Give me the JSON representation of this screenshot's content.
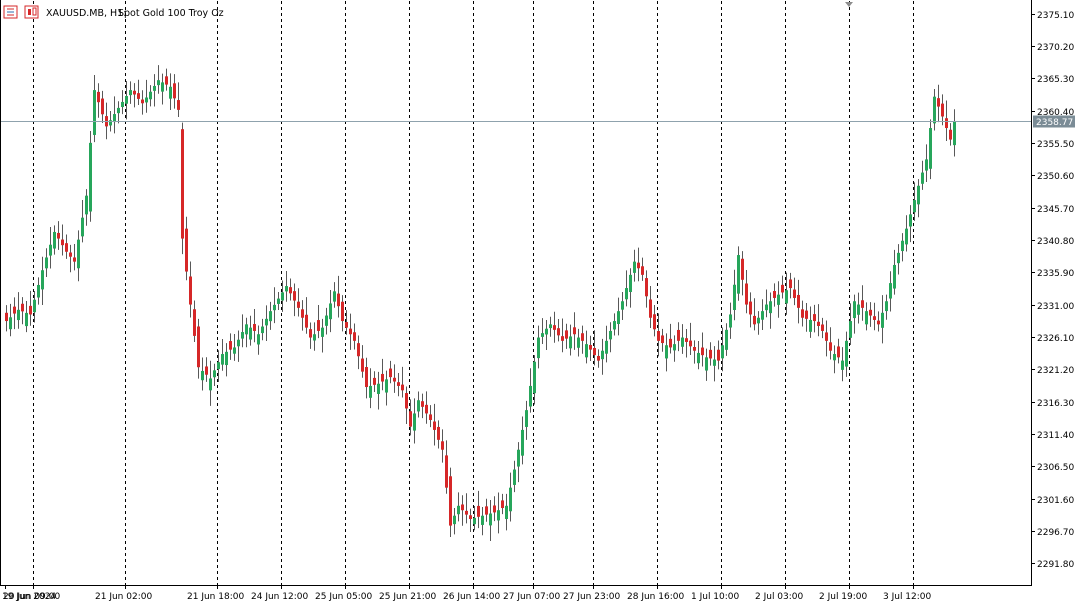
{
  "header": {
    "symbol_text": "XAUUSD.MB, H1:",
    "description": "Spot Gold 100 Troy Oz",
    "icon_names": [
      "bars-icon",
      "candles-icon"
    ]
  },
  "price_scale": {
    "labels": [
      "2375.10",
      "2370.20",
      "2365.30",
      "2360.40",
      "2355.50",
      "2350.60",
      "2345.70",
      "2340.80",
      "2335.90",
      "2331.00",
      "2326.10",
      "2321.20",
      "2316.30",
      "2311.40",
      "2306.50",
      "2301.60",
      "2296.70",
      "2291.80"
    ],
    "current_price": "2358.77"
  },
  "time_scale": {
    "labels": [
      "19 Jun 2024",
      "20 Jun 09:00",
      "21 Jun 02:00",
      "21 Jun 18:00",
      "24 Jun 12:00",
      "25 Jun 05:00",
      "25 Jun 21:00",
      "26 Jun 14:00",
      "27 Jun 07:00",
      "27 Jun 23:00",
      "28 Jun 16:00",
      "1 Jul 10:00",
      "2 Jul 03:00",
      "2 Jul 19:00",
      "3 Jul 12:00"
    ]
  },
  "colors": {
    "bull": "#26a65b",
    "bear": "#d62728",
    "wick": "#111111",
    "grid": "#000000",
    "price_line": "#8fa2ad",
    "price_label_bg": "#7b8c96"
  },
  "chart_data": {
    "type": "candlestick",
    "timeframe": "H1",
    "ylim": [
      2288.5,
      2377.0
    ],
    "anchors": [
      [
        0,
        2328.5
      ],
      [
        3,
        2330.2
      ],
      [
        6,
        2329.5
      ],
      [
        9,
        2336.2
      ],
      [
        12,
        2342.0
      ],
      [
        15,
        2339.0
      ],
      [
        17,
        2337.5
      ],
      [
        20,
        2347.5
      ],
      [
        22,
        2363.5
      ],
      [
        25,
        2358.0
      ],
      [
        28,
        2360.8
      ],
      [
        31,
        2363.5
      ],
      [
        34,
        2361.5
      ],
      [
        38,
        2365.0
      ],
      [
        41,
        2364.0
      ],
      [
        43,
        2360.5
      ],
      [
        44,
        2341.0
      ],
      [
        46,
        2331.0
      ],
      [
        48,
        2321.5
      ],
      [
        51,
        2319.8
      ],
      [
        54,
        2323.5
      ],
      [
        57,
        2324.5
      ],
      [
        60,
        2328.0
      ],
      [
        63,
        2326.5
      ],
      [
        66,
        2330.0
      ],
      [
        70,
        2333.8
      ],
      [
        73,
        2330.5
      ],
      [
        76,
        2326.0
      ],
      [
        79,
        2327.5
      ],
      [
        82,
        2333.0
      ],
      [
        84,
        2328.5
      ],
      [
        87,
        2325.5
      ],
      [
        90,
        2318.5
      ],
      [
        93,
        2319.0
      ],
      [
        96,
        2320.0
      ],
      [
        99,
        2318.0
      ],
      [
        101,
        2312.5
      ],
      [
        103,
        2316.5
      ],
      [
        106,
        2313.5
      ],
      [
        109,
        2309.0
      ],
      [
        111,
        2297.5
      ],
      [
        113,
        2300.5
      ],
      [
        116,
        2298.5
      ],
      [
        119,
        2299.0
      ],
      [
        122,
        2299.5
      ],
      [
        125,
        2300.5
      ],
      [
        127,
        2306.0
      ],
      [
        130,
        2315.0
      ],
      [
        133,
        2326.0
      ],
      [
        136,
        2328.0
      ],
      [
        139,
        2325.5
      ],
      [
        142,
        2326.5
      ],
      [
        145,
        2325.0
      ],
      [
        148,
        2322.5
      ],
      [
        151,
        2327.0
      ],
      [
        154,
        2331.5
      ],
      [
        157,
        2337.5
      ],
      [
        159,
        2335.5
      ],
      [
        161,
        2329.0
      ],
      [
        163,
        2325.5
      ],
      [
        166,
        2324.5
      ],
      [
        169,
        2326.0
      ],
      [
        172,
        2324.0
      ],
      [
        175,
        2323.0
      ],
      [
        178,
        2322.5
      ],
      [
        181,
        2329.5
      ],
      [
        183,
        2338.5
      ],
      [
        185,
        2331.0
      ],
      [
        187,
        2328.0
      ],
      [
        190,
        2331.0
      ],
      [
        193,
        2332.5
      ],
      [
        196,
        2333.5
      ],
      [
        199,
        2329.0
      ],
      [
        202,
        2328.5
      ],
      [
        204,
        2327.0
      ],
      [
        206,
        2324.0
      ],
      [
        209,
        2322.5
      ],
      [
        212,
        2331.5
      ],
      [
        215,
        2330.0
      ],
      [
        218,
        2328.0
      ],
      [
        220,
        2331.5
      ],
      [
        222,
        2337.0
      ],
      [
        225,
        2342.5
      ],
      [
        228,
        2349.0
      ],
      [
        230,
        2353.0
      ],
      [
        232,
        2362.5
      ],
      [
        234,
        2359.5
      ],
      [
        236,
        2356.0
      ],
      [
        237,
        2358.8
      ]
    ],
    "pattern": {
      "body_scale": [
        0.55,
        1.1,
        0.35,
        0.85,
        0.45,
        1.3,
        0.6,
        0.25,
        0.95,
        0.7
      ],
      "wick_up": [
        0.35,
        0.9,
        0.5,
        1.3,
        0.25,
        0.75,
        1.05,
        0.45
      ],
      "wick_dn": [
        0.6,
        0.3,
        1.1,
        0.45,
        0.85,
        0.2,
        0.7
      ]
    },
    "total_candles": 238
  }
}
